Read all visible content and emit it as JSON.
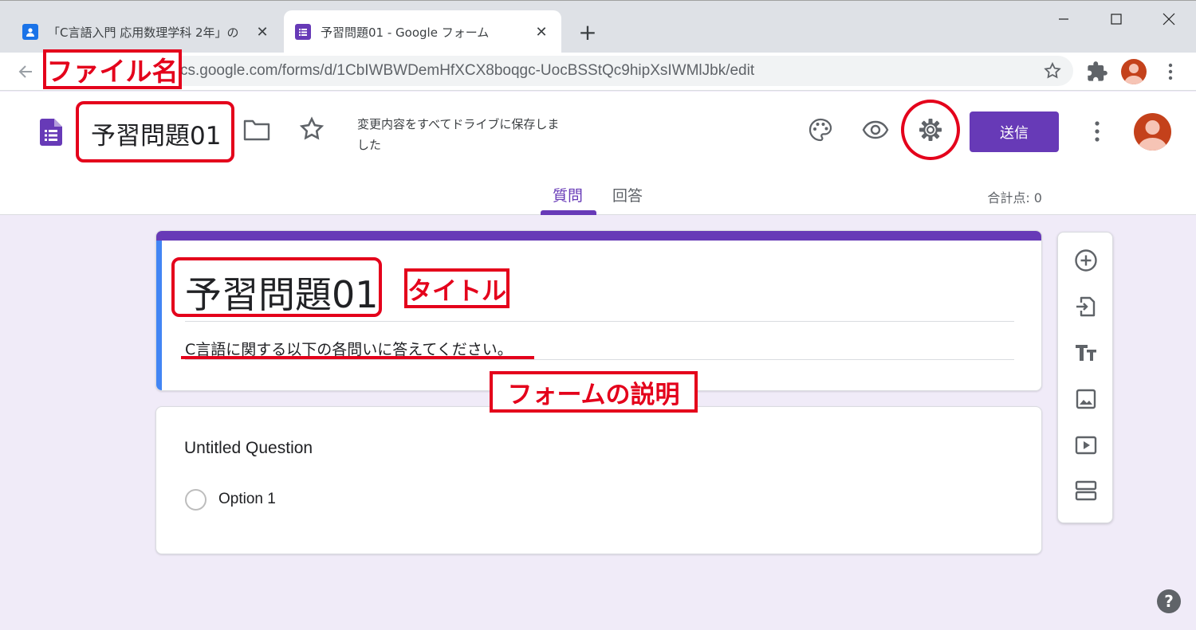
{
  "browser": {
    "tabs": [
      {
        "title": "「C言語入門 応用数理学科 2年」の",
        "icon": "classroom-icon",
        "color": "#1a73e8"
      },
      {
        "title": "予習問題01 - Google フォーム",
        "icon": "forms-icon",
        "color": "#673ab7"
      }
    ],
    "new_tab_label": "+",
    "close_label": "✕",
    "url": "cs.google.com/forms/d/1CbIWBWDemHfXCX8boqgc-UocBSStQc9hipXsIWMlJbk/edit"
  },
  "header": {
    "filename": "予習問題01",
    "save_status": "変更内容をすべてドライブに保存しました",
    "send_label": "送信",
    "tabs": [
      "質問",
      "回答"
    ],
    "points": "合計点: 0",
    "accent_color": "#673ab7"
  },
  "form": {
    "title": "予習問題01",
    "description": "C言語に関する以下の各問いに答えてください。",
    "question": {
      "title": "Untitled Question",
      "option": "Option 1"
    }
  },
  "side_tools": [
    "add-question-icon",
    "import-questions-icon",
    "add-title-icon",
    "add-image-icon",
    "add-video-icon",
    "add-section-icon"
  ],
  "annotations": {
    "filename_label": "ファイル名",
    "title_label": "タイトル",
    "description_label": "フォームの説明",
    "color": "#e4001b"
  },
  "help_label": "?"
}
